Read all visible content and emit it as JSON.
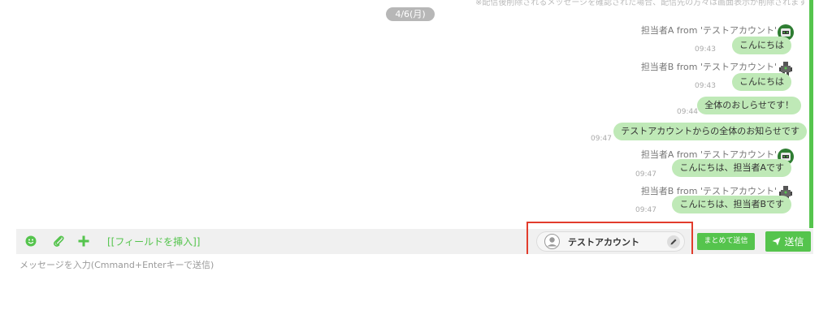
{
  "chat": {
    "top_notice": "※配信後削除されるメッセージを確認された場合、配信先の方々は画面表示が削除されます",
    "date_label": "4/6(月)",
    "messages": [
      {
        "sender": "担当者A from 'テストアカウント'",
        "time": "09:43",
        "text": "こんにちは",
        "avatar": "robot-green-avatar-icon"
      },
      {
        "sender": "担当者B from 'テストアカウント'",
        "time": "09:43",
        "text": "こんにちは",
        "avatar": "robot-dark-avatar-icon"
      },
      {
        "time": "09:44",
        "text": "全体のおしらせです！"
      },
      {
        "time": "09:47",
        "text": "テストアカウントからの全体のお知らせです"
      },
      {
        "sender": "担当者A from 'テストアカウント'",
        "time": "09:47",
        "text": "こんにちは、担当者Aです",
        "avatar": "robot-green-avatar-icon"
      },
      {
        "sender": "担当者B from 'テストアカウント'",
        "time": "09:47",
        "text": "こんにちは、担当者Bです",
        "avatar": "robot-dark-avatar-icon"
      }
    ]
  },
  "toolbar": {
    "icons": [
      "emoji-icon",
      "attachment-icon",
      "add-icon"
    ],
    "insert_field_label": "[[フィールドを挿入]]"
  },
  "account": {
    "name": "テストアカウント",
    "icon": "user-avatar-icon",
    "edit_icon": "pencil-icon"
  },
  "actions": {
    "bulk_send_label": "まとめて送信",
    "send_label": "送信",
    "send_icon": "paper-plane-icon"
  },
  "input": {
    "placeholder": "メッセージを入力(Cmmand+Enterキーで送信)"
  },
  "colors": {
    "accent": "#55c44d",
    "bubble": "#bfe9b7",
    "highlight_border": "#e23c2c"
  }
}
